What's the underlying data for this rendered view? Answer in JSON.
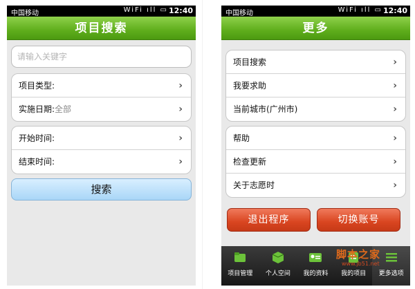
{
  "left": {
    "status": {
      "carrier": "中国移动",
      "icons": "WiFi ıll ▭",
      "time": "12:40"
    },
    "title": "项目搜索",
    "search": {
      "placeholder": "请输入关键字"
    },
    "filters": [
      {
        "label": "项目类型:",
        "value": ""
      },
      {
        "label": "实施日期:",
        "value": "全部"
      }
    ],
    "times": [
      {
        "label": "开始时间:"
      },
      {
        "label": "结束时间:"
      }
    ],
    "search_button": "搜索"
  },
  "right": {
    "status": {
      "carrier": "中国移动",
      "icons": "WiFi ıll ▭",
      "time": "12:40"
    },
    "title": "更多",
    "menu1": [
      "项目搜索",
      "我要求助",
      "当前城市(广州市)"
    ],
    "menu2": [
      "帮助",
      "检查更新",
      "关于志愿时"
    ],
    "logout_button": "退出程序",
    "switch_button": "切换账号",
    "tabs": [
      {
        "label": "项目管理",
        "icon": "folder-icon"
      },
      {
        "label": "个人空间",
        "icon": "box-icon"
      },
      {
        "label": "我的资料",
        "icon": "profile-card-icon"
      },
      {
        "label": "我的项目",
        "icon": "project-icon"
      },
      {
        "label": "更多选项",
        "icon": "more-options-icon"
      }
    ]
  },
  "watermark": {
    "main": "脚本之家",
    "sub": "www.jb51.net"
  },
  "colors": {
    "title_green": "#5fae1c",
    "button_red": "#d94520",
    "button_blue": "#a9d6f7"
  }
}
